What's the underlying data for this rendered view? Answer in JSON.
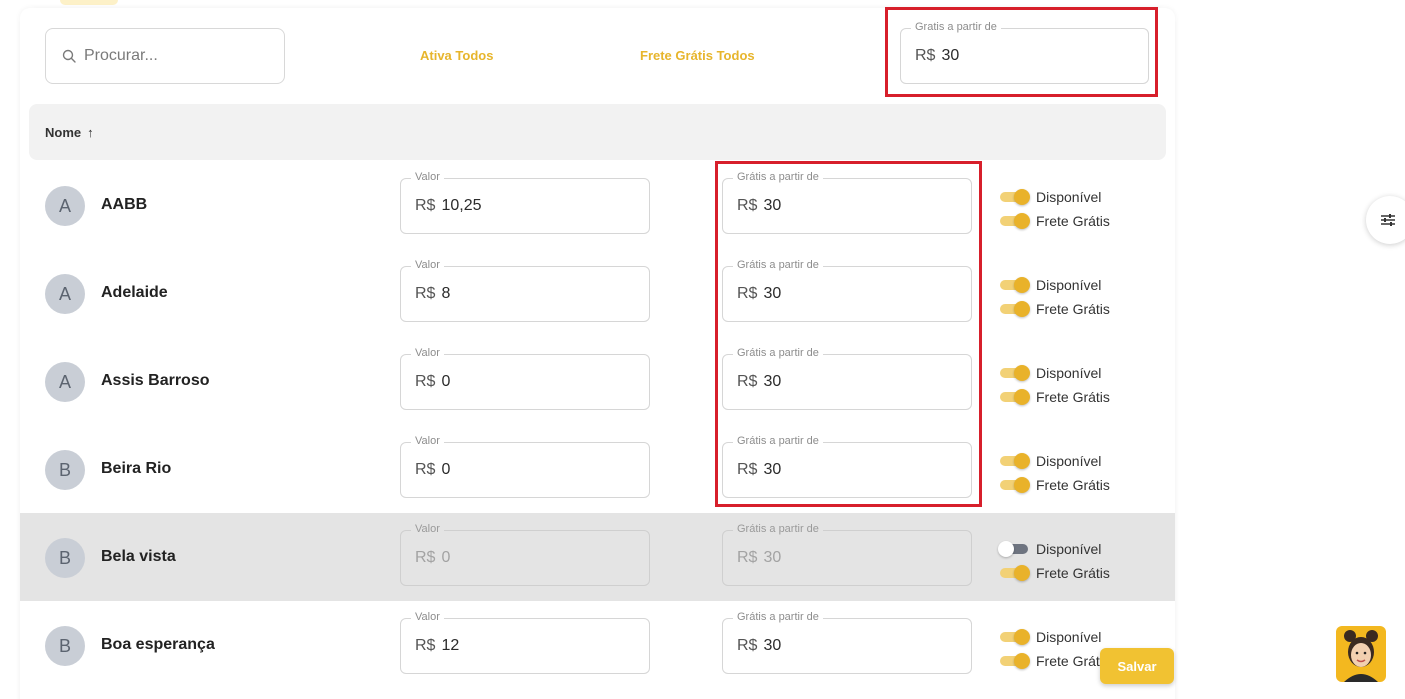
{
  "toolbar": {
    "search_placeholder": "Procurar...",
    "ativa_todos_label": "Ativa Todos",
    "frete_gratis_todos_label": "Frete Grátis Todos",
    "gratis_field_label": "Gratis a partir de",
    "gratis_field_currency": "R$",
    "gratis_field_value": "30"
  },
  "table": {
    "header_label": "Nome",
    "header_sort_icon": "↑",
    "valor_label": "Valor",
    "gratis_label": "Grátis a partir de",
    "currency": "R$",
    "disponivel_label": "Disponível",
    "frete_gratis_label": "Frete Grátis",
    "rows": [
      {
        "initial": "A",
        "name": "AABB",
        "valor": "10,25",
        "gratis": "30",
        "disponivel": true,
        "frete_gratis": true
      },
      {
        "initial": "A",
        "name": "Adelaide",
        "valor": "8",
        "gratis": "30",
        "disponivel": true,
        "frete_gratis": true
      },
      {
        "initial": "A",
        "name": "Assis Barroso",
        "valor": "0",
        "gratis": "30",
        "disponivel": true,
        "frete_gratis": true
      },
      {
        "initial": "B",
        "name": "Beira Rio",
        "valor": "0",
        "gratis": "30",
        "disponivel": true,
        "frete_gratis": true
      },
      {
        "initial": "B",
        "name": "Bela vista",
        "valor": "0",
        "gratis": "30",
        "disponivel": false,
        "frete_gratis": true
      },
      {
        "initial": "B",
        "name": "Boa esperança",
        "valor": "12",
        "gratis": "30",
        "disponivel": true,
        "frete_gratis": true
      }
    ]
  },
  "actions": {
    "salvar_label": "Salvar"
  },
  "colors": {
    "accent": "#e9b22a",
    "highlight_border": "#d71f2b",
    "disabled_row": "#e4e4e4"
  },
  "icons": {
    "search": "search-icon",
    "filter": "sliders-icon",
    "sort": "arrow-up-icon",
    "chat": "chat-assistant-avatar"
  }
}
